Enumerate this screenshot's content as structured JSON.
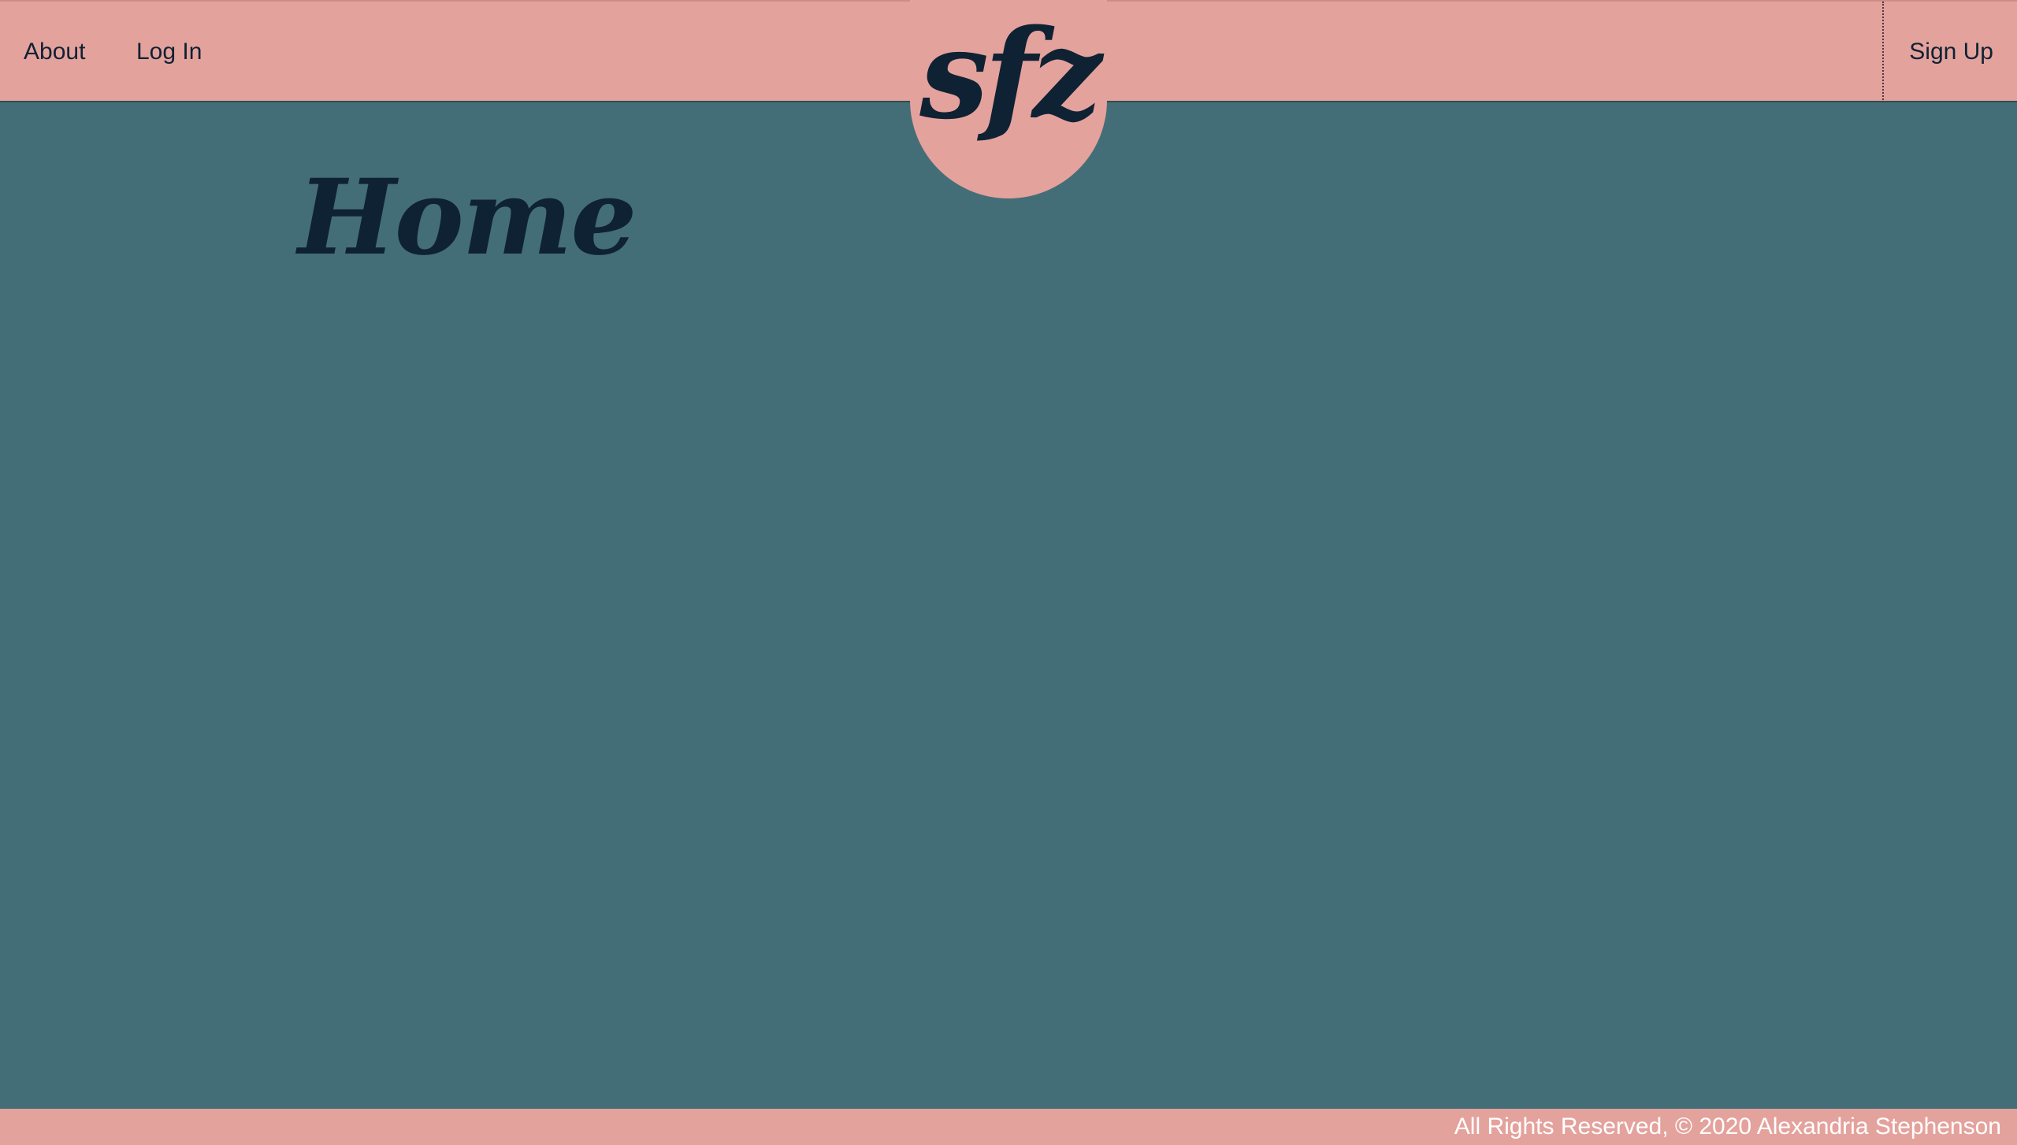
{
  "nav": {
    "about": "About",
    "login": "Log In",
    "signup": "Sign Up"
  },
  "logo": {
    "text": "sfz"
  },
  "main": {
    "title": "Home"
  },
  "footer": {
    "copyright": "All Rights Reserved, © 2020 Alexandria Stephenson"
  },
  "colors": {
    "header_bg": "#e4a29d",
    "page_bg": "#446e77",
    "text_dark": "#0f2233",
    "footer_text": "#ffffff"
  }
}
